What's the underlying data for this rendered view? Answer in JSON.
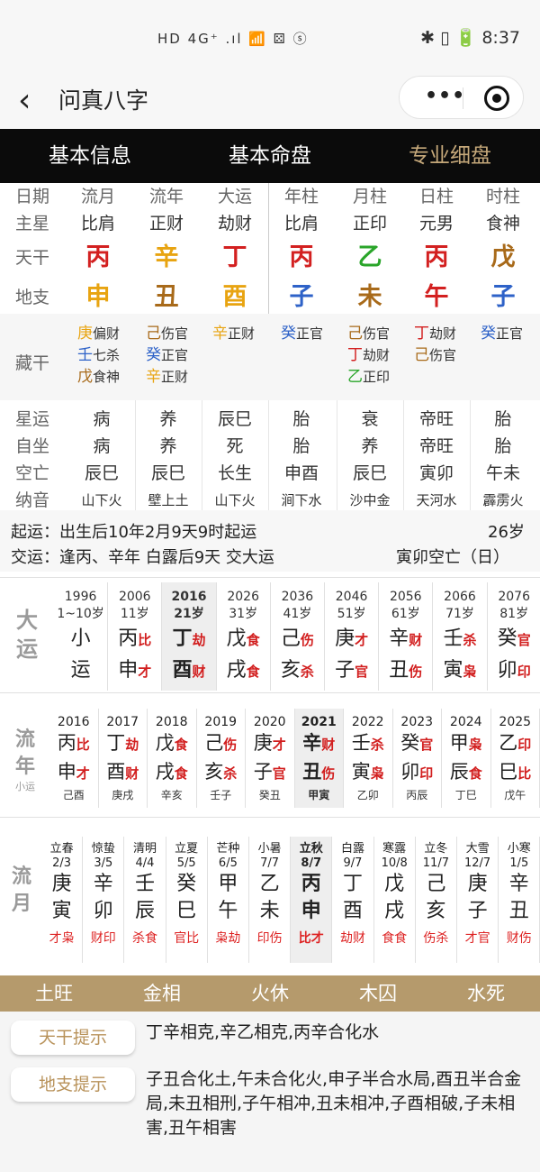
{
  "status_bar": {
    "left_icons": "HD 4G⁺ .ıl 📶 ⚄ ⓢ",
    "right_icons": "✱ ▯ 🔋",
    "time": "8:37"
  },
  "nav": {
    "title": "问真八字"
  },
  "tabs": [
    "基本信息",
    "基本命盘",
    "专业细盘"
  ],
  "pillars": {
    "labels": [
      "日期",
      "主星",
      "天干",
      "地支"
    ],
    "headers": [
      "流月",
      "流年",
      "大运",
      "年柱",
      "月柱",
      "日柱",
      "时柱"
    ],
    "zhuxing": [
      "比肩",
      "正财",
      "劫财",
      "比肩",
      "正印",
      "元男",
      "食神"
    ],
    "tiangan": [
      {
        "t": "丙",
        "c": "#d32020"
      },
      {
        "t": "辛",
        "c": "#e8a411"
      },
      {
        "t": "丁",
        "c": "#d32020"
      },
      {
        "t": "丙",
        "c": "#d32020"
      },
      {
        "t": "乙",
        "c": "#2aa52a"
      },
      {
        "t": "丙",
        "c": "#d32020"
      },
      {
        "t": "戊",
        "c": "#a86a1a"
      }
    ],
    "dizhi": [
      {
        "t": "申",
        "c": "#e8a411"
      },
      {
        "t": "丑",
        "c": "#a86a1a"
      },
      {
        "t": "酉",
        "c": "#e8a411"
      },
      {
        "t": "子",
        "c": "#2e62c8"
      },
      {
        "t": "未",
        "c": "#a86a1a"
      },
      {
        "t": "午",
        "c": "#d32020"
      },
      {
        "t": "子",
        "c": "#2e62c8"
      }
    ]
  },
  "canggan": {
    "label": "藏干",
    "cols": [
      [
        {
          "g": "庚",
          "c": "#e8a411",
          "s": "偏财"
        },
        {
          "g": "壬",
          "c": "#2e62c8",
          "s": "七杀"
        },
        {
          "g": "戊",
          "c": "#a86a1a",
          "s": "食神"
        }
      ],
      [
        {
          "g": "己",
          "c": "#a86a1a",
          "s": "伤官"
        },
        {
          "g": "癸",
          "c": "#2e62c8",
          "s": "正官"
        },
        {
          "g": "辛",
          "c": "#e8a411",
          "s": "正财"
        }
      ],
      [
        {
          "g": "辛",
          "c": "#e8a411",
          "s": "正财"
        }
      ],
      [
        {
          "g": "癸",
          "c": "#2e62c8",
          "s": "正官"
        }
      ],
      [
        {
          "g": "己",
          "c": "#a86a1a",
          "s": "伤官"
        },
        {
          "g": "丁",
          "c": "#d32020",
          "s": "劫财"
        },
        {
          "g": "乙",
          "c": "#2aa52a",
          "s": "正印"
        }
      ],
      [
        {
          "g": "丁",
          "c": "#d32020",
          "s": "劫财"
        },
        {
          "g": "己",
          "c": "#a86a1a",
          "s": "伤官"
        }
      ],
      [
        {
          "g": "癸",
          "c": "#2e62c8",
          "s": "正官"
        }
      ]
    ]
  },
  "xingyun": {
    "labels": [
      "星运",
      "自坐",
      "空亡",
      "纳音"
    ],
    "cols": [
      [
        "病",
        "病",
        "辰巳",
        "山下火"
      ],
      [
        "养",
        "养",
        "辰巳",
        "壁上土"
      ],
      [
        "辰巳",
        "死",
        "长生",
        "山下火"
      ],
      [
        "胎",
        "胎",
        "申酉",
        "涧下水"
      ],
      [
        "衰",
        "养",
        "辰巳",
        "沙中金"
      ],
      [
        "帝旺",
        "帝旺",
        "寅卯",
        "天河水"
      ],
      [
        "胎",
        "胎",
        "午未",
        "霹雳火"
      ]
    ]
  },
  "qiyun": {
    "line1": "起运：出生后10年2月9天9时起运",
    "age": "26岁",
    "line2": "交运：逢丙、辛年 白露后9天 交大运",
    "kongwang": "寅卯空亡（日）"
  },
  "dayun": {
    "label": [
      "大",
      "运"
    ],
    "cells": [
      {
        "yr": "1996",
        "ag": "1~10岁",
        "g": "小",
        "gs": "",
        "gc": "#222",
        "z": "运",
        "zs": "",
        "zc": "#222"
      },
      {
        "yr": "2006",
        "ag": "11岁",
        "g": "丙",
        "gs": "比",
        "gc": "#d21f1f",
        "z": "申",
        "zs": "才",
        "zc": "#d21f1f"
      },
      {
        "yr": "2016",
        "ag": "21岁",
        "g": "丁",
        "gs": "劫",
        "gc": "#d21f1f",
        "z": "酉",
        "zs": "财",
        "zc": "#d21f1f"
      },
      {
        "yr": "2026",
        "ag": "31岁",
        "g": "戊",
        "gs": "食",
        "gc": "#d21f1f",
        "z": "戌",
        "zs": "食",
        "zc": "#d21f1f"
      },
      {
        "yr": "2036",
        "ag": "41岁",
        "g": "己",
        "gs": "伤",
        "gc": "#d21f1f",
        "z": "亥",
        "zs": "杀",
        "zc": "#d21f1f"
      },
      {
        "yr": "2046",
        "ag": "51岁",
        "g": "庚",
        "gs": "才",
        "gc": "#d21f1f",
        "z": "子",
        "zs": "官",
        "zc": "#d21f1f"
      },
      {
        "yr": "2056",
        "ag": "61岁",
        "g": "辛",
        "gs": "财",
        "gc": "#d21f1f",
        "z": "丑",
        "zs": "伤",
        "zc": "#d21f1f"
      },
      {
        "yr": "2066",
        "ag": "71岁",
        "g": "壬",
        "gs": "杀",
        "gc": "#d21f1f",
        "z": "寅",
        "zs": "枭",
        "zc": "#d21f1f"
      },
      {
        "yr": "2076",
        "ag": "81岁",
        "g": "癸",
        "gs": "官",
        "gc": "#d21f1f",
        "z": "卯",
        "zs": "印",
        "zc": "#d21f1f"
      }
    ]
  },
  "liunian": {
    "label": [
      "流",
      "年"
    ],
    "sub": "小运",
    "cells": [
      {
        "yr": "2016",
        "g": "丙",
        "gs": "比",
        "z": "申",
        "zs": "才",
        "x": "己酉"
      },
      {
        "yr": "2017",
        "g": "丁",
        "gs": "劫",
        "z": "酉",
        "zs": "财",
        "x": "庚戌"
      },
      {
        "yr": "2018",
        "g": "戊",
        "gs": "食",
        "z": "戌",
        "zs": "食",
        "x": "辛亥"
      },
      {
        "yr": "2019",
        "g": "己",
        "gs": "伤",
        "z": "亥",
        "zs": "杀",
        "x": "壬子"
      },
      {
        "yr": "2020",
        "g": "庚",
        "gs": "才",
        "z": "子",
        "zs": "官",
        "x": "癸丑"
      },
      {
        "yr": "2021",
        "g": "辛",
        "gs": "财",
        "z": "丑",
        "zs": "伤",
        "x": "甲寅"
      },
      {
        "yr": "2022",
        "g": "壬",
        "gs": "杀",
        "z": "寅",
        "zs": "枭",
        "x": "乙卯"
      },
      {
        "yr": "2023",
        "g": "癸",
        "gs": "官",
        "z": "卯",
        "zs": "印",
        "x": "丙辰"
      },
      {
        "yr": "2024",
        "g": "甲",
        "gs": "枭",
        "z": "辰",
        "zs": "食",
        "x": "丁巳"
      },
      {
        "yr": "2025",
        "g": "乙",
        "gs": "印",
        "z": "巳",
        "zs": "比",
        "x": "戊午"
      }
    ]
  },
  "liuyue": {
    "label": [
      "流",
      "月"
    ],
    "cells": [
      {
        "jq": "立春",
        "d": "2/3",
        "g": "庚",
        "z": "寅",
        "ss": "才枭"
      },
      {
        "jq": "惊蛰",
        "d": "3/5",
        "g": "辛",
        "z": "卯",
        "ss": "财印"
      },
      {
        "jq": "清明",
        "d": "4/4",
        "g": "壬",
        "z": "辰",
        "ss": "杀食"
      },
      {
        "jq": "立夏",
        "d": "5/5",
        "g": "癸",
        "z": "巳",
        "ss": "官比"
      },
      {
        "jq": "芒种",
        "d": "6/5",
        "g": "甲",
        "z": "午",
        "ss": "枭劫"
      },
      {
        "jq": "小暑",
        "d": "7/7",
        "g": "乙",
        "z": "未",
        "ss": "印伤"
      },
      {
        "jq": "立秋",
        "d": "8/7",
        "g": "丙",
        "z": "申",
        "ss": "比才"
      },
      {
        "jq": "白露",
        "d": "9/7",
        "g": "丁",
        "z": "酉",
        "ss": "劫财"
      },
      {
        "jq": "寒露",
        "d": "10/8",
        "g": "戊",
        "z": "戌",
        "ss": "食食"
      },
      {
        "jq": "立冬",
        "d": "11/7",
        "g": "己",
        "z": "亥",
        "ss": "伤杀"
      },
      {
        "jq": "大雪",
        "d": "12/7",
        "g": "庚",
        "z": "子",
        "ss": "才官"
      },
      {
        "jq": "小寒",
        "d": "1/5",
        "g": "辛",
        "z": "丑",
        "ss": "财伤"
      }
    ]
  },
  "wuxing": [
    "土旺",
    "金相",
    "火休",
    "木囚",
    "水死"
  ],
  "hints": {
    "tiangan_label": "天干提示",
    "tiangan_text": "丁辛相克,辛乙相克,丙辛合化水",
    "dizhi_label": "地支提示",
    "dizhi_text": "子丑合化土,午未合化火,申子半合水局,酉丑半合金局,未丑相刑,子午相冲,丑未相冲,子酉相破,子未相害,丑午相害"
  }
}
